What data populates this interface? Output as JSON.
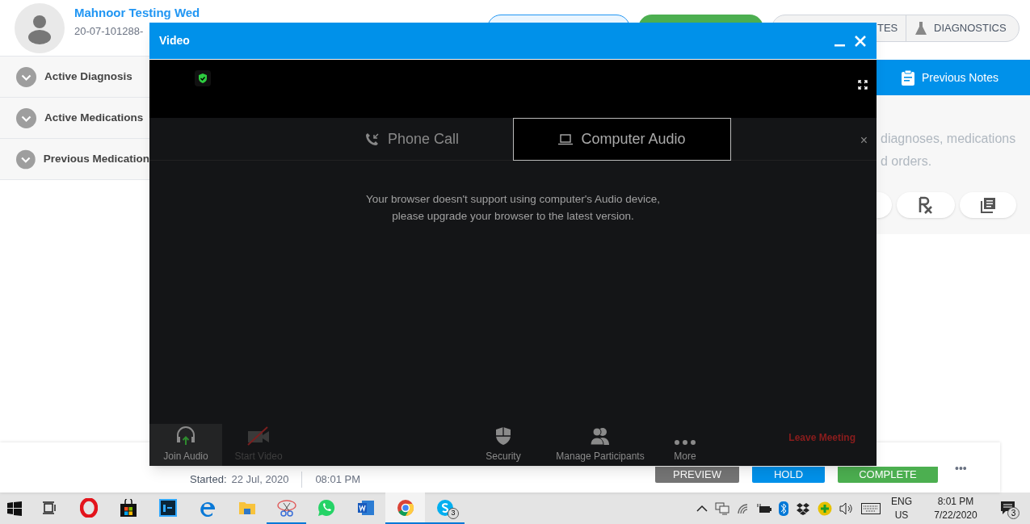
{
  "header": {
    "patient_name": "Mahnoor Testing Wed",
    "patient_id": "20-07-101288-",
    "tabs": [
      {
        "label": "TES"
      },
      {
        "label": "DIAGNOSTICS"
      }
    ]
  },
  "sidebar": {
    "items": [
      {
        "label": "Active Diagnosis"
      },
      {
        "label": "Active Medications"
      },
      {
        "label": "Previous Medication"
      }
    ]
  },
  "right_panel": {
    "tab": "Previous Notes",
    "text_lines": [
      "diagnoses, medications",
      "d orders."
    ]
  },
  "bottom_bar": {
    "started_label": "Started:",
    "date": "22 Jul, 2020",
    "time": "08:01 PM",
    "buttons": [
      {
        "label": "PREVIEW",
        "kind": "preview"
      },
      {
        "label": "HOLD",
        "kind": "hold"
      },
      {
        "label": "COMPLETE",
        "kind": "complete"
      }
    ],
    "more": "•••"
  },
  "video_modal": {
    "title": "Video",
    "audio_tabs": [
      {
        "label": "Phone Call",
        "selected": false
      },
      {
        "label": "Computer Audio",
        "selected": true
      }
    ],
    "message": "Your browser doesn't support using computer's Audio device, please upgrade your browser to the latest version.",
    "toolbar": [
      {
        "label": "Join Audio",
        "selected": true,
        "disabled": false
      },
      {
        "label": "Start Video",
        "selected": false,
        "disabled": true
      },
      {
        "label": "Security",
        "selected": false,
        "disabled": false
      },
      {
        "label": "Manage Participants",
        "selected": false,
        "disabled": false
      },
      {
        "label": "More",
        "selected": false,
        "disabled": false
      }
    ],
    "leave": "Leave Meeting",
    "dismiss": "×"
  },
  "taskbar": {
    "apps": [
      {
        "selected": false,
        "running": false
      },
      {
        "selected": false,
        "running": false
      },
      {
        "selected": false,
        "running": false
      },
      {
        "selected": false,
        "running": false
      },
      {
        "selected": false,
        "running": false
      },
      {
        "selected": false,
        "running": false
      },
      {
        "selected": false,
        "running": true
      },
      {
        "selected": false,
        "running": false
      },
      {
        "selected": false,
        "running": false
      },
      {
        "selected": true,
        "running": true
      },
      {
        "selected": false,
        "running": true,
        "badge": "3"
      }
    ],
    "language": "ENG",
    "region": "US",
    "clock_time": "8:01 PM",
    "clock_date": "7/22/2020",
    "notification_badge": "3"
  }
}
